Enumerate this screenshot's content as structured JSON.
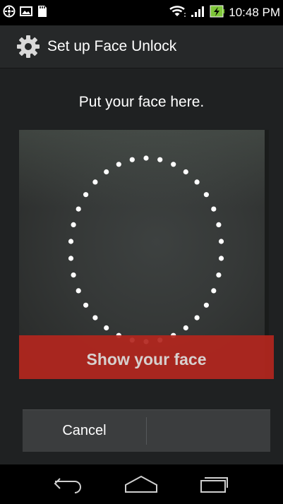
{
  "status_bar": {
    "time": "10:48 PM",
    "left_icons": [
      "clock-icon",
      "image-icon",
      "sd-card-icon"
    ],
    "right_icons": [
      "wifi-icon",
      "signal-icon",
      "battery-charging-icon"
    ]
  },
  "action_bar": {
    "icon": "gear-icon",
    "title": "Set up Face Unlock"
  },
  "instruction": "Put your face here.",
  "camera": {
    "hint": "Show your face"
  },
  "buttons": {
    "cancel": "Cancel",
    "continue": ""
  },
  "nav": [
    "back-icon",
    "home-icon",
    "recent-apps-icon"
  ],
  "colors": {
    "action_bar": "#262829",
    "content_bg": "#1f2122",
    "hint_banner": "#b3261e",
    "button_bar": "#3b3d3e",
    "battery_green": "#7ec639"
  }
}
